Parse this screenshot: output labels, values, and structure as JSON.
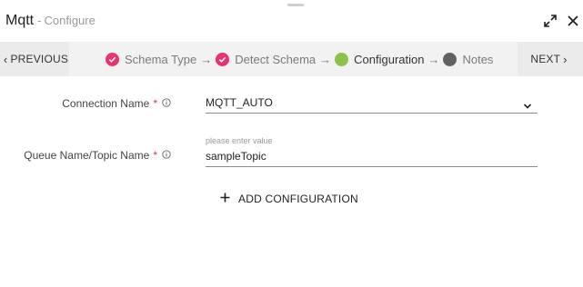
{
  "header": {
    "app_name": "Mqtt",
    "separator": "-",
    "mode": "Configure",
    "expand_icon": "expand-icon",
    "close_icon": "close-icon"
  },
  "wizard": {
    "previous_label": "PREVIOUS",
    "next_label": "NEXT",
    "arrow": "→",
    "steps": [
      {
        "label": "Schema Type",
        "status": "done",
        "color": "#e8336d"
      },
      {
        "label": "Detect Schema",
        "status": "done",
        "color": "#e8336d"
      },
      {
        "label": "Configuration",
        "status": "active",
        "color": "#8bc34a"
      },
      {
        "label": "Notes",
        "status": "pending",
        "color": "#616161"
      }
    ]
  },
  "form": {
    "connection": {
      "label": "Connection Name",
      "required_mark": "*",
      "value": "MQTT_AUTO"
    },
    "queue": {
      "label": "Queue Name/Topic Name",
      "required_mark": "*",
      "helper": "please enter value",
      "value": "sampleTopic"
    },
    "add_configuration_label": "ADD CONFIGURATION"
  },
  "colors": {
    "required": "#e0315b",
    "done": "#e8336d",
    "active": "#8bc34a",
    "pending": "#616161"
  }
}
